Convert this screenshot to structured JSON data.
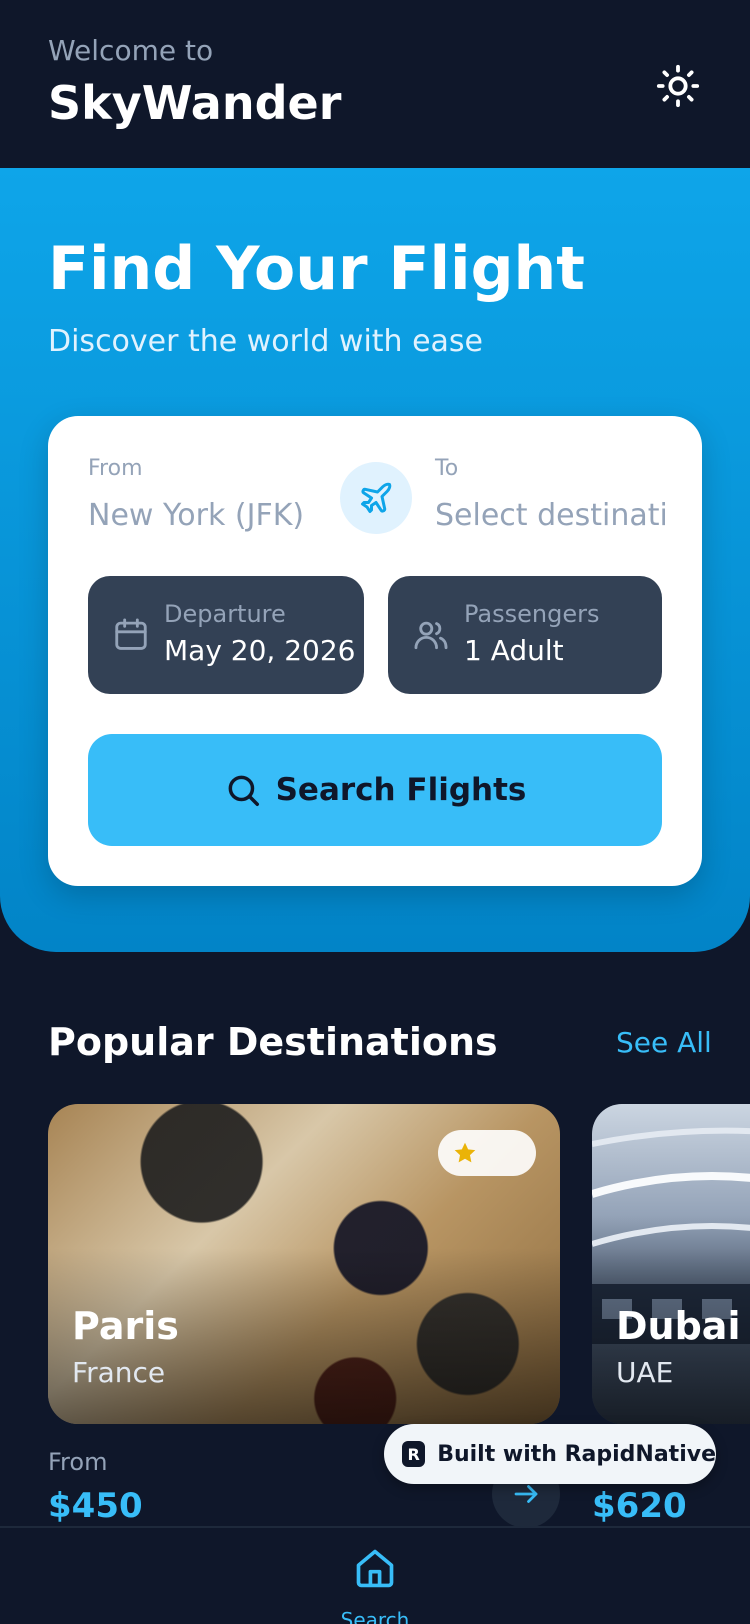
{
  "header": {
    "welcome": "Welcome to",
    "app_name": "SkyWander",
    "theme_icon": "sun-icon"
  },
  "hero": {
    "title": "Find Your Flight",
    "subtitle": "Discover the world with ease"
  },
  "search_card": {
    "from_label": "From",
    "from_value": "New York (JFK)",
    "to_label": "To",
    "to_placeholder": "Select destination",
    "swap_icon": "plane-icon",
    "departure_label": "Departure",
    "departure_value": "May 20, 2026",
    "passengers_label": "Passengers",
    "passengers_value": "1 Adult",
    "search_button": "Search Flights"
  },
  "popular": {
    "title": "Popular Destinations",
    "see_all": "See All",
    "destinations": [
      {
        "city": "Paris",
        "country": "France",
        "price_label": "From",
        "price": "$450",
        "rating_icon": "star-icon"
      },
      {
        "city": "Dubai",
        "country": "UAE",
        "price": "$620"
      }
    ]
  },
  "badge": {
    "text": "Built with RapidNative"
  },
  "bottom_nav": {
    "items": [
      {
        "label": "Search",
        "icon": "home-icon"
      }
    ]
  },
  "colors": {
    "background": "#0f172a",
    "accent": "#38bdf8",
    "hero": "#0ea5e9",
    "pill": "#334155"
  }
}
